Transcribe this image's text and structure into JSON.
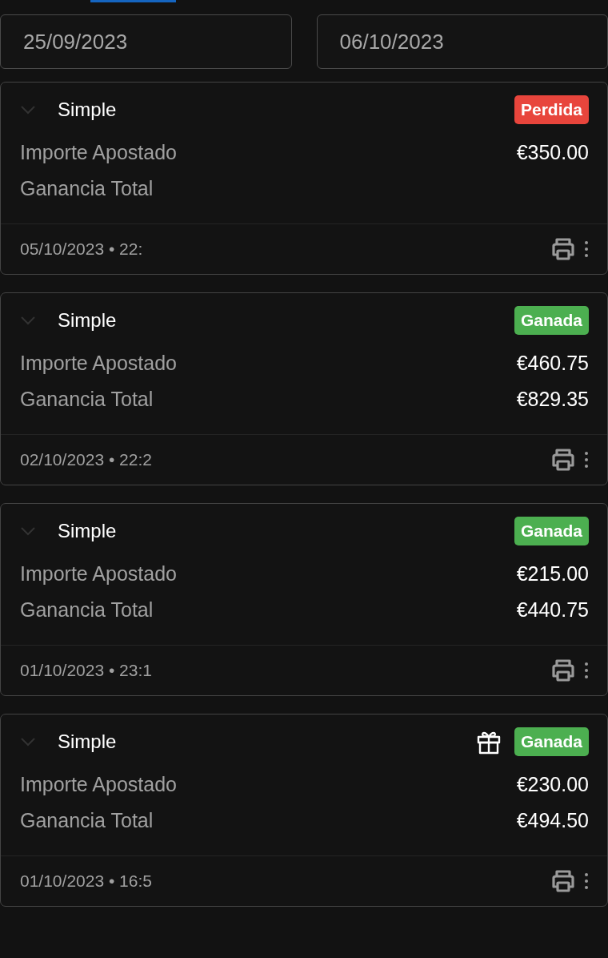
{
  "date_range": [
    {
      "value": "25/09/2023"
    },
    {
      "value": "06/10/2023"
    }
  ],
  "bets": [
    {
      "type": "Simple",
      "expanded": false,
      "gift": false,
      "status": {
        "label": "Perdida",
        "kind": "lost"
      },
      "rows": [
        {
          "label": "Importe Apostado",
          "value": "€350.00"
        },
        {
          "label": "Ganancia Total",
          "value": null
        }
      ],
      "datetime": "05/10/2023 • 22:"
    },
    {
      "type": "Simple",
      "expanded": false,
      "gift": false,
      "status": {
        "label": "Ganada",
        "kind": "won"
      },
      "rows": [
        {
          "label": "Importe Apostado",
          "value": "€460.75"
        },
        {
          "label": "Ganancia Total",
          "value": "€829.35"
        }
      ],
      "datetime": "02/10/2023 • 22:2"
    },
    {
      "type": "Simple",
      "expanded": false,
      "gift": false,
      "status": {
        "label": "Ganada",
        "kind": "won"
      },
      "rows": [
        {
          "label": "Importe Apostado",
          "value": "€215.00"
        },
        {
          "label": "Ganancia Total",
          "value": "€440.75"
        }
      ],
      "datetime": "01/10/2023 • 23:1"
    },
    {
      "type": "Simple",
      "expanded": false,
      "gift": true,
      "status": {
        "label": "Ganada",
        "kind": "won"
      },
      "rows": [
        {
          "label": "Importe Apostado",
          "value": "€230.00"
        },
        {
          "label": "Ganancia Total",
          "value": "€494.50"
        }
      ],
      "datetime": "01/10/2023 • 16:5"
    }
  ]
}
